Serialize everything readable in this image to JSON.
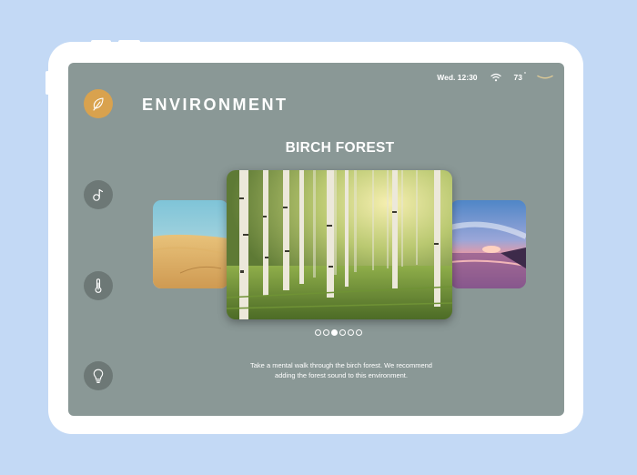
{
  "status_bar": {
    "datetime": "Wed. 12:30",
    "temperature": "73",
    "temperature_unit": "°",
    "icons": [
      "wifi-icon",
      "swipe-handle-icon"
    ]
  },
  "header": {
    "title": "ENVIRONMENT"
  },
  "sidebar": {
    "items": [
      {
        "name": "environment",
        "icon": "leaf-icon",
        "active": true
      },
      {
        "name": "music",
        "icon": "music-note-icon",
        "active": false
      },
      {
        "name": "temperature",
        "icon": "thermometer-icon",
        "active": false
      },
      {
        "name": "lighting",
        "icon": "lightbulb-icon",
        "active": false
      }
    ]
  },
  "carousel": {
    "title": "BIRCH FOREST",
    "slides": [
      {
        "name": "beach-dunes",
        "position": "left"
      },
      {
        "name": "birch-forest",
        "position": "center"
      },
      {
        "name": "sunset-lake",
        "position": "right"
      }
    ],
    "page_count": 6,
    "active_page": 3
  },
  "description": "Take a mental walk through the birch forest. We recommend adding the forest sound to this environment.",
  "colors": {
    "page_background": "#c3d9f5",
    "screen_background": "#8a9896",
    "accent": "#d9a24e",
    "button_background": "#6d7876"
  }
}
